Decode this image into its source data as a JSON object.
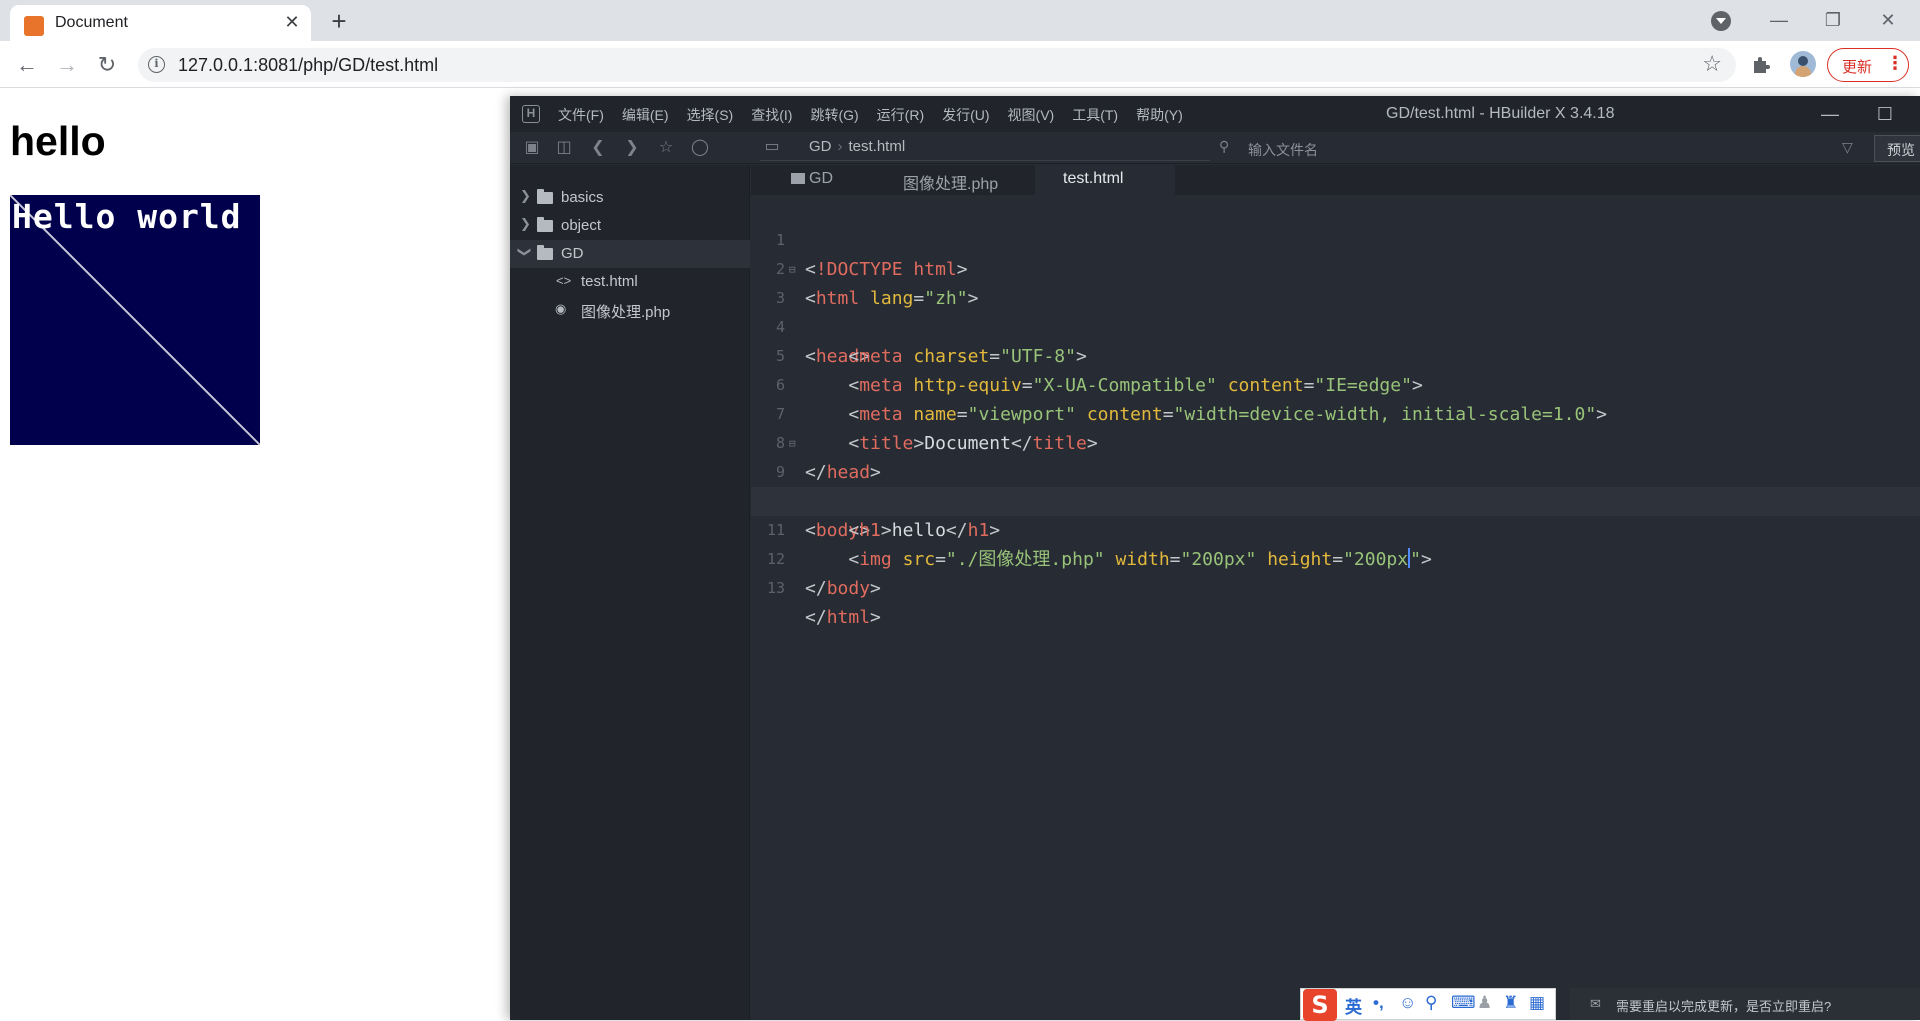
{
  "browser": {
    "tab_title": "Document",
    "tab_close": "✕",
    "new_tab": "+",
    "url": "127.0.0.1:8081/php/GD/test.html",
    "update_label": "更新",
    "update_menu": "⋮"
  },
  "page": {
    "heading": "hello",
    "image_text": "Hello world"
  },
  "hbuilder": {
    "menu": [
      "文件(F)",
      "编辑(E)",
      "选择(S)",
      "查找(I)",
      "跳转(G)",
      "运行(R)",
      "发行(U)",
      "视图(V)",
      "工具(T)",
      "帮助(Y)"
    ],
    "window_title": "GD/test.html - HBuilder X 3.4.18",
    "breadcrumb": [
      "GD",
      "test.html"
    ],
    "file_search_placeholder": "输入文件名",
    "preview_label": "预览",
    "tree": [
      {
        "label": "basics",
        "type": "folder",
        "expanded": false
      },
      {
        "label": "object",
        "type": "folder",
        "expanded": false
      },
      {
        "label": "GD",
        "type": "folder",
        "expanded": true
      },
      {
        "label": "test.html",
        "type": "html-file"
      },
      {
        "label": "图像处理.php",
        "type": "php-file"
      }
    ],
    "tabs": [
      "GD",
      "图像处理.php",
      "test.html"
    ],
    "active_tab": "test.html",
    "code_lines": [
      "<!DOCTYPE html>",
      "<html lang=\"zh\">",
      "<head>",
      "    <meta charset=\"UTF-8\">",
      "    <meta http-equiv=\"X-UA-Compatible\" content=\"IE=edge\">",
      "    <meta name=\"viewport\" content=\"width=device-width, initial-scale=1.0\">",
      "    <title>Document</title>",
      "</head>",
      "<body>",
      "    <h1>hello</h1>",
      "    <img src=\"./图像处理.php\" width=\"200px\" height=\"200px\">",
      "</body>",
      "</html>"
    ],
    "current_line": 11
  },
  "ime": {
    "mode": "英",
    "punct": "•,"
  },
  "notification": {
    "text": "需要重启以完成更新，是否立即重启?"
  },
  "colors": {
    "editor_bg": "#272b33",
    "sidebar_bg": "#21252b",
    "tag": "#e06c5f",
    "attr": "#e2b93d",
    "string": "#98c379",
    "update_red": "#d93025",
    "image_bg": "#00004d"
  }
}
